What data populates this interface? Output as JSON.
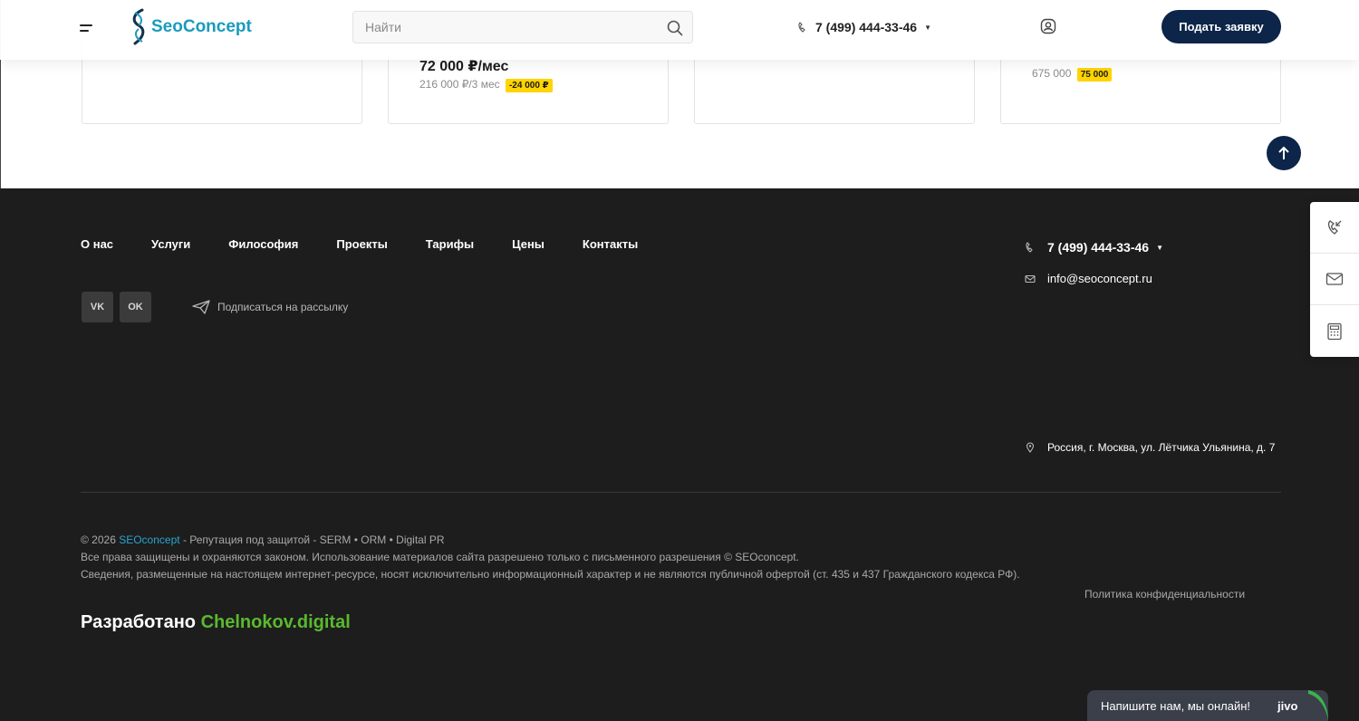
{
  "header": {
    "logo_text": "SeoConcept",
    "search_placeholder": "Найти",
    "phone": "7 (499) 444-33-46",
    "cta_label": "Подать заявку"
  },
  "cards": [
    {
      "price": "",
      "old_price": "",
      "discount": ""
    },
    {
      "price": "72 000 ₽/мес",
      "old_price": "216 000 ₽/3 мес",
      "discount": "-24 000 ₽"
    },
    {
      "price": "",
      "old_price": "",
      "discount": ""
    },
    {
      "price": "",
      "old_price": "675 000",
      "discount": "75 000"
    }
  ],
  "footer": {
    "nav": [
      "О нас",
      "Услуги",
      "Философия",
      "Проекты",
      "Тарифы",
      "Цены",
      "Контакты"
    ],
    "socials": [
      "VK",
      "OK"
    ],
    "subscribe_label": "Подписаться на рассылку",
    "phone": "7 (499) 444-33-46",
    "email": "info@seoconcept.ru",
    "address": "Россия, г. Москва, ул. Лётчика Ульянина, д. 7",
    "copyright_prefix": "© 2026",
    "copyright_brand": "SEOconcept",
    "copyright_suffix": "- Репутация под защитой - SERM • ORM • Digital PR",
    "rights": "Все права защищены и охраняются законом. Использование материалов сайта разрешено только с письменного разрешения © SEOconcept.",
    "disclaimer": "Сведения, размещенные на настоящем интернет-ресурсе, носят исключительно информационный характер и не являются публичной офертой (ст. 435 и 437 Гражданского кодекса РФ).",
    "policy": "Политика конфиденциальности",
    "dev_prefix": "Разработано",
    "dev_brand": "Chelnokov.digital"
  },
  "chat": {
    "label": "Напишите нам, мы онлайн!",
    "brand": "jivo"
  },
  "colors": {
    "navy": "#0c2549",
    "footer_bg": "#1d1d1d",
    "accent_blue": "#2aa3d1",
    "dev_green": "#5ab92e",
    "badge_yellow": "#ffd400"
  }
}
